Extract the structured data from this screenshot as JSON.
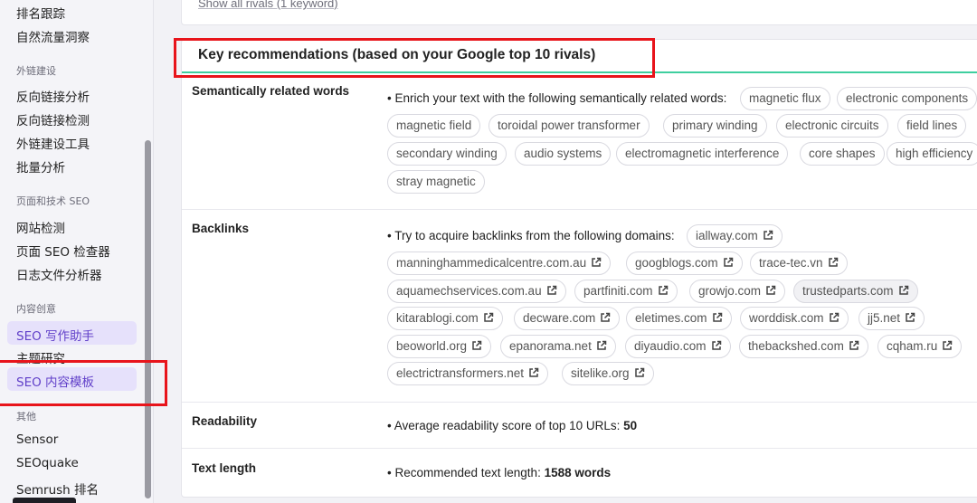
{
  "sidebar": {
    "items": [
      {
        "type": "item",
        "label": "排名跟踪"
      },
      {
        "type": "item",
        "label": "自然流量洞察"
      },
      {
        "type": "head",
        "label": "外链建设"
      },
      {
        "type": "item",
        "label": "反向链接分析"
      },
      {
        "type": "item",
        "label": "反向链接检测"
      },
      {
        "type": "item",
        "label": "外链建设工具"
      },
      {
        "type": "item",
        "label": "批量分析"
      },
      {
        "type": "head",
        "label": "页面和技术 SEO"
      },
      {
        "type": "item",
        "label": "网站检测"
      },
      {
        "type": "item",
        "label": "页面 SEO 检查器"
      },
      {
        "type": "item",
        "label": "日志文件分析器"
      },
      {
        "type": "head",
        "label": "内容创意"
      },
      {
        "type": "item",
        "label": "SEO 写作助手",
        "active": true
      },
      {
        "type": "item",
        "label": "主题研究"
      },
      {
        "type": "item",
        "label": "SEO 内容模板",
        "active": true
      },
      {
        "type": "head",
        "label": "其他"
      },
      {
        "type": "item",
        "label": "Sensor"
      },
      {
        "type": "item",
        "label": "SEOquake"
      },
      {
        "type": "item",
        "label": "Semrush 排名"
      }
    ]
  },
  "top_link": "Show all rivals (1 keyword)",
  "card": {
    "title": "Key recommendations (based on your Google top 10 rivals)",
    "semantic": {
      "label": "Semantically related words",
      "intro": "• Enrich your text with the following semantically related words:",
      "chips": [
        "magnetic flux",
        "electronic components",
        "magnetic field",
        "toroidal power transformer",
        "primary winding",
        "electronic circuits",
        "field lines",
        "secondary winding",
        "audio systems",
        "electromagnetic interference",
        "core shapes",
        "high efficiency",
        "stray magnetic"
      ]
    },
    "backlinks": {
      "label": "Backlinks",
      "intro": "• Try to acquire backlinks from the following domains:",
      "chips": [
        "iallway.com",
        "manninghammedicalcentre.com.au",
        "googblogs.com",
        "trace-tec.vn",
        "aquamechservices.com.au",
        "partfiniti.com",
        "growjo.com",
        "trustedparts.com",
        "kitarablogi.com",
        "decware.com",
        "eletimes.com",
        "worddisk.com",
        "jj5.net",
        "beoworld.org",
        "epanorama.net",
        "diyaudio.com",
        "thebackshed.com",
        "cqham.ru",
        "electrictransformers.net",
        "sitelike.org"
      ]
    },
    "readability": {
      "label": "Readability",
      "intro": "• Average readability score of top 10 URLs:",
      "value": "50"
    },
    "text_length": {
      "label": "Text length",
      "intro": "• Recommended text length:",
      "value": "1588 words"
    }
  },
  "colors": {
    "accent_underline": "#3ecf9f",
    "highlight_red": "#e8141b",
    "active_bg": "#e6e1fb",
    "active_text": "#6140c9"
  }
}
